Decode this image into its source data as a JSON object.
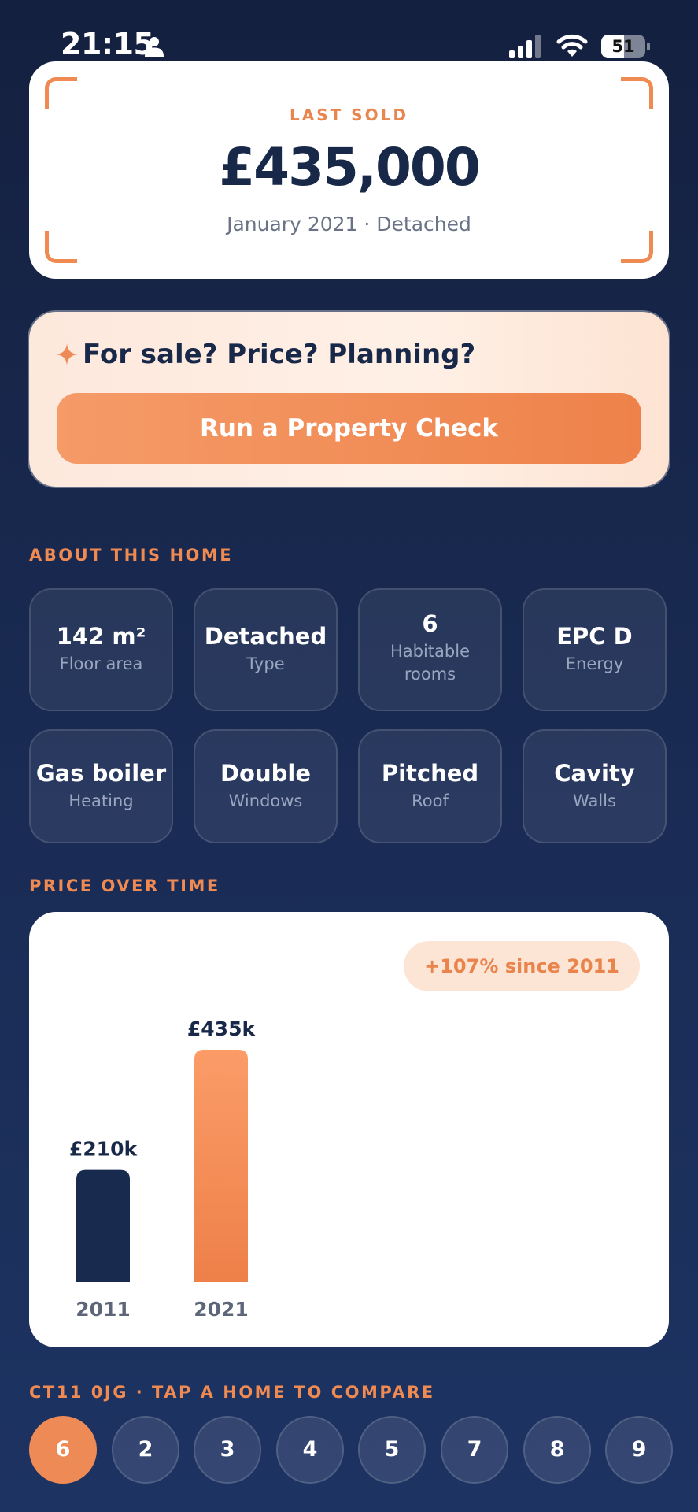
{
  "status_bar": {
    "time": "21:15",
    "battery": "51",
    "battery_level": 0.51
  },
  "last_sold": {
    "label": "LAST SOLD",
    "price": "£435,000",
    "subtitle": "January 2021 · Detached"
  },
  "property_check": {
    "prompt": "For sale? Price? Planning?",
    "button_label": "Run a Property Check"
  },
  "about": {
    "heading": "ABOUT THIS HOME",
    "tiles": [
      {
        "value": "142 m²",
        "label": "Floor area"
      },
      {
        "value": "Detached",
        "label": "Type"
      },
      {
        "value": "6",
        "label": "Habitable rooms"
      },
      {
        "value": "EPC D",
        "label": "Energy"
      },
      {
        "value": "Gas boiler",
        "label": "Heating"
      },
      {
        "value": "Double",
        "label": "Windows"
      },
      {
        "value": "Pitched",
        "label": "Roof"
      },
      {
        "value": "Cavity",
        "label": "Walls"
      }
    ]
  },
  "price_over_time": {
    "heading": "PRICE OVER TIME",
    "badge": "+107% since 2011"
  },
  "chart_data": {
    "type": "bar",
    "categories": [
      "2011",
      "2021"
    ],
    "values": [
      210,
      435
    ],
    "value_labels": [
      "£210k",
      "£435k"
    ],
    "title": "",
    "xlabel": "",
    "ylabel": "",
    "grid": false,
    "colors": [
      "#182a4e",
      "#f08a52"
    ]
  },
  "compare": {
    "heading": "CT11 0JG · TAP A HOME TO COMPARE",
    "items": [
      "6",
      "2",
      "3",
      "4",
      "5",
      "7",
      "8",
      "9"
    ],
    "active_index": 0
  }
}
